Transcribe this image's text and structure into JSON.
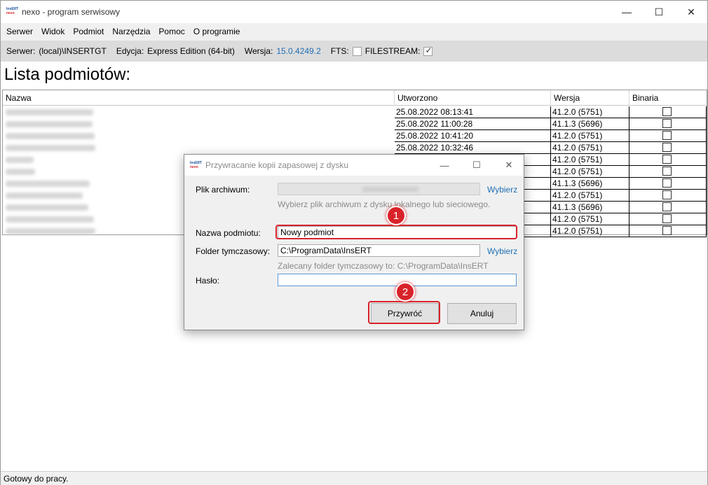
{
  "window": {
    "title": "nexo - program serwisowy",
    "logo_line1": "InsERT",
    "logo_line2": "nexo",
    "minimize": "—",
    "maximize": "☐",
    "close": "✕"
  },
  "menu": [
    "Serwer",
    "Widok",
    "Podmiot",
    "Narzędzia",
    "Pomoc",
    "O programie"
  ],
  "info": {
    "server_label": "Serwer:",
    "server_value": "(local)\\INSERTGT",
    "edition_label": "Edycja:",
    "edition_value": "Express Edition (64-bit)",
    "version_label": "Wersja:",
    "version_value": "15.0.4249.2",
    "fts_label": "FTS:",
    "fts_checked": false,
    "filestream_label": "FILESTREAM:",
    "filestream_checked": true
  },
  "list_title": "Lista podmiotów:",
  "grid": {
    "columns": [
      "Nazwa",
      "Utworzono",
      "Wersja",
      "Binaria"
    ],
    "rows": [
      {
        "created": "25.08.2022 08:13:41",
        "version": "41.2.0 (5751)"
      },
      {
        "created": "25.08.2022 11:00:28",
        "version": "41.1.3 (5696)"
      },
      {
        "created": "25.08.2022 10:41:20",
        "version": "41.2.0 (5751)"
      },
      {
        "created": "25.08.2022 10:32:46",
        "version": "41.2.0 (5751)"
      },
      {
        "created": "",
        "version": "41.2.0 (5751)"
      },
      {
        "created": "",
        "version": "41.2.0 (5751)"
      },
      {
        "created": "",
        "version": "41.1.3 (5696)"
      },
      {
        "created": "",
        "version": "41.2.0 (5751)"
      },
      {
        "created": "",
        "version": "41.1.3 (5696)"
      },
      {
        "created": "",
        "version": "41.2.0 (5751)"
      },
      {
        "created": "",
        "version": "41.2.0 (5751)"
      }
    ]
  },
  "status": "Gotowy do pracy.",
  "dialog": {
    "title": "Przywracanie kopii zapasowej z dysku",
    "archive_label": "Plik archiwum:",
    "archive_hint": "Wybierz plik archiwum z dysku lokalnego lub sieciowego.",
    "browse_label": "Wybierz",
    "entity_label": "Nazwa podmiotu:",
    "entity_value": "Nowy podmiot",
    "temp_label": "Folder tymczasowy:",
    "temp_value": "C:\\ProgramData\\InsERT",
    "temp_hint": "Zalecany folder tymczasowy to: C:\\ProgramData\\InsERT",
    "password_label": "Hasło:",
    "password_value": "",
    "restore_button": "Przywróć",
    "cancel_button": "Anuluj"
  },
  "annotations": {
    "badge1": "1",
    "badge2": "2",
    "color": "#d8232a"
  }
}
